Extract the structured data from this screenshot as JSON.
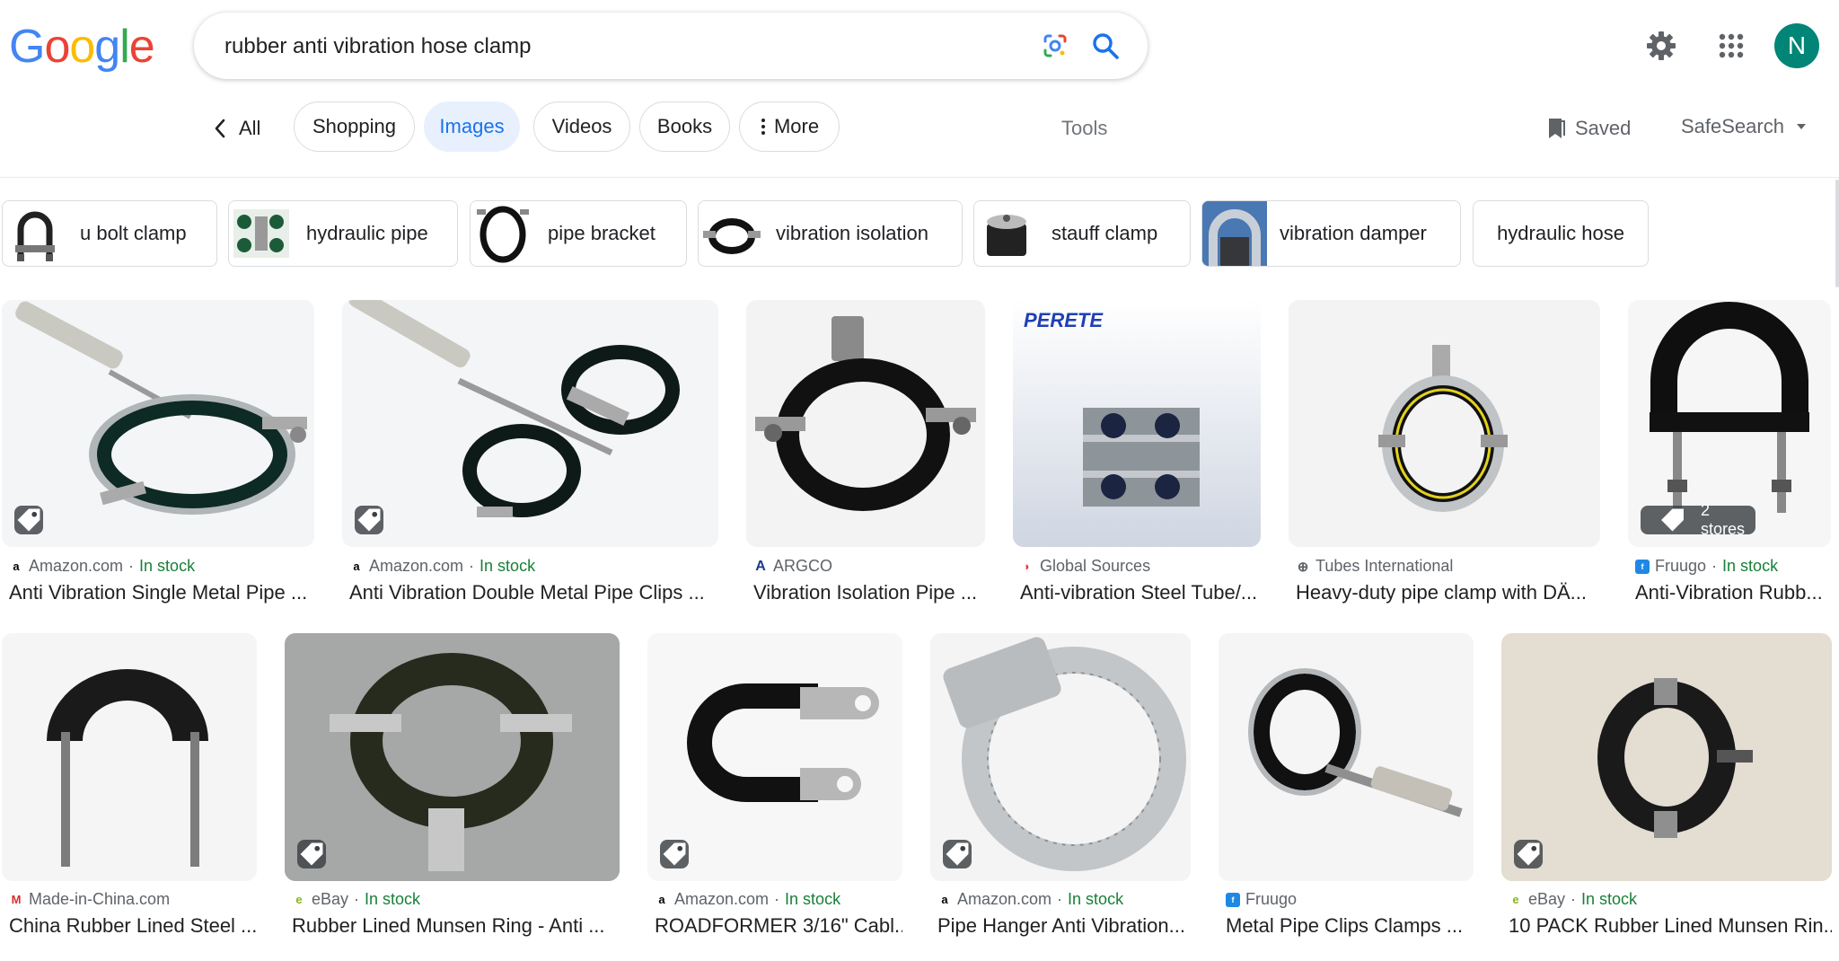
{
  "logo": {
    "letters": [
      "G",
      "o",
      "o",
      "g",
      "l",
      "e"
    ],
    "colors": [
      "#4285f4",
      "#ea4335",
      "#fbbc05",
      "#4285f4",
      "#34a853",
      "#ea4335"
    ]
  },
  "search": {
    "query": "rubber anti vibration hose clamp",
    "lens_icon": "google-lens-icon",
    "search_icon": "search-icon"
  },
  "header": {
    "settings_icon": "gear-icon",
    "apps_icon": "apps-grid-icon",
    "avatar_letter": "N",
    "avatar_color": "#008577"
  },
  "tabs": {
    "back_label": "All",
    "items": [
      "Shopping",
      "Images",
      "Videos",
      "Books",
      "More"
    ],
    "active": "Images",
    "tools": "Tools",
    "saved": "Saved",
    "safesearch": "SafeSearch"
  },
  "related": [
    "u bolt clamp",
    "hydraulic pipe",
    "pipe bracket",
    "vibration isolation",
    "stauff clamp",
    "vibration damper",
    "hydraulic hose"
  ],
  "results_row1": [
    {
      "source": "Amazon.com",
      "stock": "In stock",
      "title": "Anti Vibration Single Metal Pipe ...",
      "badge": "tag"
    },
    {
      "source": "Amazon.com",
      "stock": "In stock",
      "title": "Anti Vibration Double Metal Pipe Clips ...",
      "badge": "tag"
    },
    {
      "source": "ARGCO",
      "stock": "",
      "title": "Vibration Isolation Pipe ...",
      "badge": ""
    },
    {
      "source": "Global Sources",
      "stock": "",
      "title": "Anti-vibration Steel Tube/...",
      "badge": "",
      "image_text": "PERETE"
    },
    {
      "source": "Tubes International",
      "stock": "",
      "title": "Heavy-duty pipe clamp with DÄ...",
      "badge": ""
    },
    {
      "source": "Fruugo",
      "stock": "In stock",
      "title": "Anti-Vibration Rubb...",
      "badge": "2 stores"
    }
  ],
  "results_row2": [
    {
      "source": "Made-in-China.com",
      "stock": "",
      "title": "China Rubber Lined Steel ...",
      "badge": ""
    },
    {
      "source": "eBay",
      "stock": "In stock",
      "title": "Rubber Lined Munsen Ring - Anti ...",
      "badge": "tag"
    },
    {
      "source": "Amazon.com",
      "stock": "In stock",
      "title": "ROADFORMER 3/16\" Cabl...",
      "badge": "tag"
    },
    {
      "source": "Amazon.com",
      "stock": "In stock",
      "title": "Pipe Hanger Anti Vibration...",
      "badge": "tag"
    },
    {
      "source": "Fruugo",
      "stock": "",
      "title": "Metal Pipe Clips Clamps ...",
      "badge": ""
    },
    {
      "source": "eBay",
      "stock": "In stock",
      "title": "10 PACK Rubber Lined Munsen Rin...",
      "badge": "tag"
    }
  ],
  "colors": {
    "accent": "#1a73e8",
    "stock_green": "#188038",
    "muted": "#5f6368"
  }
}
